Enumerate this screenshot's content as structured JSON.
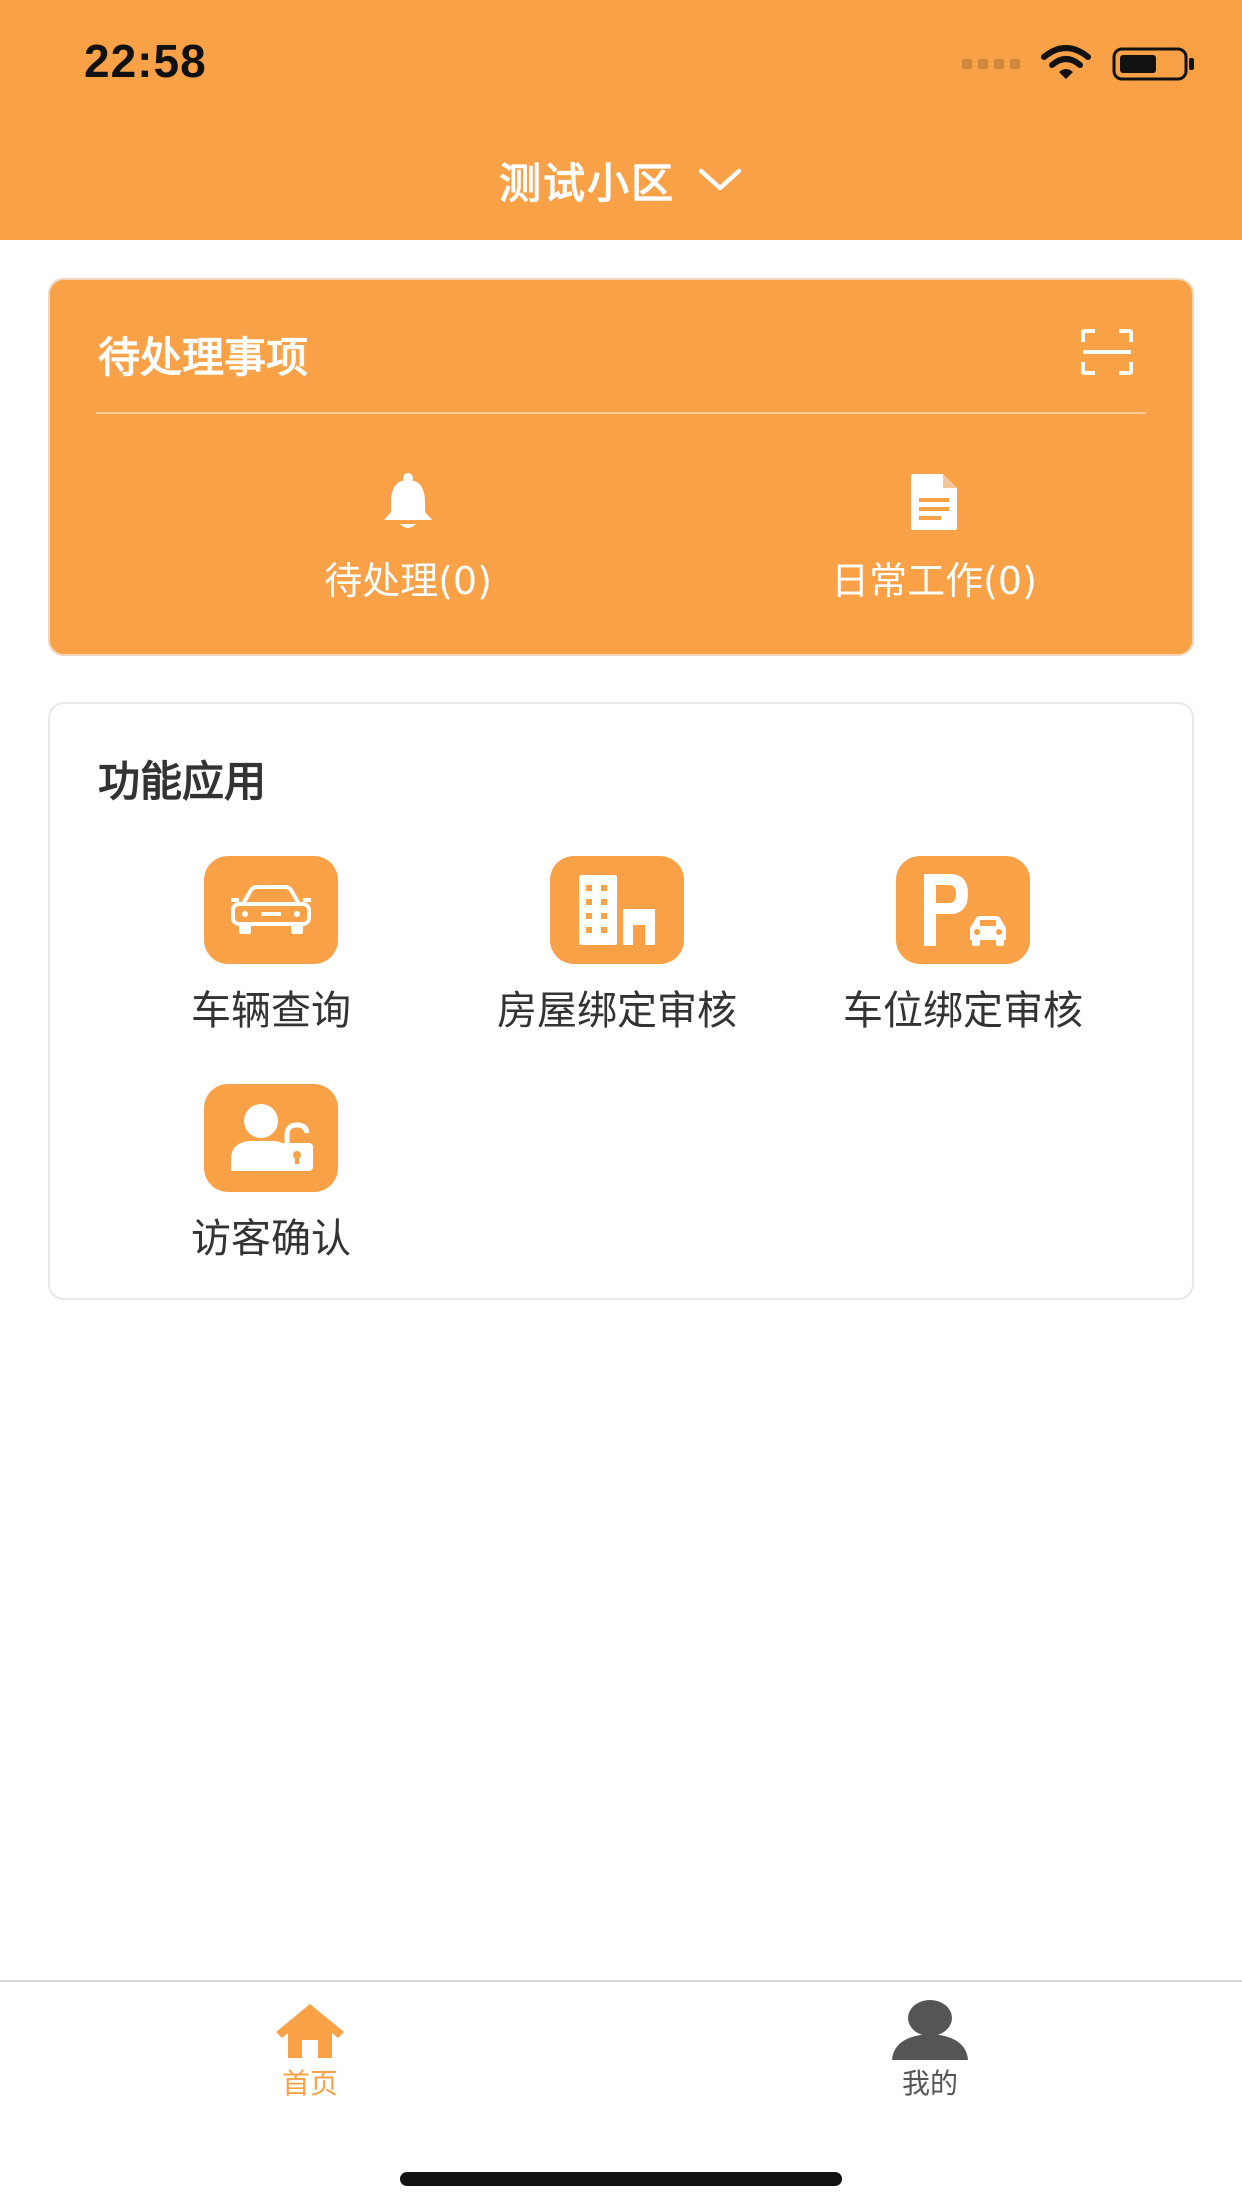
{
  "status_bar": {
    "time": "22:58"
  },
  "header": {
    "community_name": "测试小区"
  },
  "pending": {
    "title": "待处理事项",
    "items": [
      {
        "label": "待处理(0)",
        "icon": "bell-icon"
      },
      {
        "label": "日常工作(0)",
        "icon": "document-icon"
      }
    ]
  },
  "functions": {
    "title": "功能应用",
    "items": [
      {
        "label": "车辆查询",
        "icon": "car-icon"
      },
      {
        "label": "房屋绑定审核",
        "icon": "building-icon"
      },
      {
        "label": "车位绑定审核",
        "icon": "parking-icon"
      },
      {
        "label": "访客确认",
        "icon": "visitor-lock-icon"
      }
    ]
  },
  "tabbar": {
    "home_label": "首页",
    "mine_label": "我的"
  },
  "colors": {
    "accent": "#F8A147",
    "text": "#333333",
    "inactive": "#555555"
  }
}
